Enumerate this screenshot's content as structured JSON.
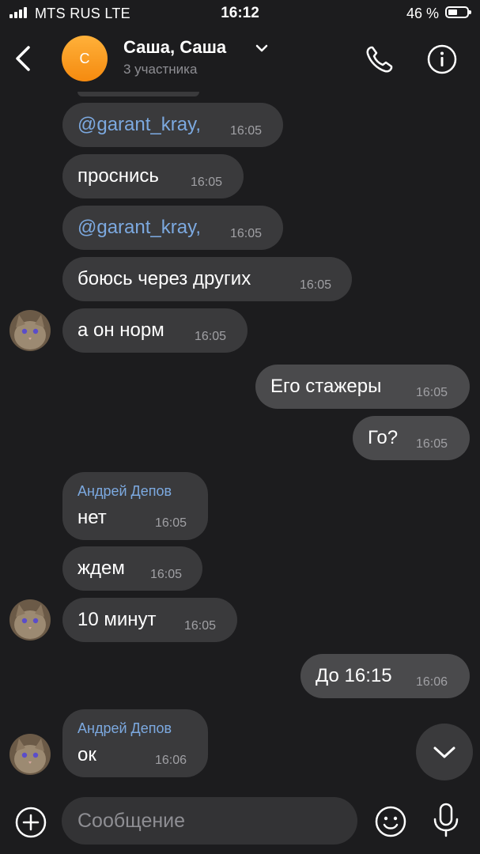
{
  "status": {
    "carrier": "MTS RUS  LTE",
    "time": "16:12",
    "battery": "46 %"
  },
  "header": {
    "avatar_letter": "С",
    "title": "Саша, Саша",
    "subtitle": "3 участника"
  },
  "messages": [
    {
      "id": "m1",
      "text": "@garant_kray,",
      "time": "16:05",
      "mention": true
    },
    {
      "id": "m2",
      "text": "проснись",
      "time": "16:05"
    },
    {
      "id": "m3",
      "text": "@garant_kray,",
      "time": "16:05",
      "mention": true
    },
    {
      "id": "m4",
      "text": "боюсь через других",
      "time": "16:05"
    },
    {
      "id": "m5",
      "text": "а он норм",
      "time": "16:05"
    },
    {
      "id": "m6",
      "text": "Его стажеры",
      "time": "16:05",
      "outgoing": true
    },
    {
      "id": "m7",
      "text": "Го?",
      "time": "16:05",
      "outgoing": true
    },
    {
      "id": "m8",
      "sender": "Андрей Депов",
      "text": "нет",
      "time": "16:05"
    },
    {
      "id": "m9",
      "text": "ждем",
      "time": "16:05"
    },
    {
      "id": "m10",
      "text": "10 минут",
      "time": "16:05"
    },
    {
      "id": "m11",
      "text": "До 16:15",
      "time": "16:06",
      "outgoing": true
    },
    {
      "id": "m12",
      "sender": "Андрей Депов",
      "text": "ок",
      "time": "16:06"
    }
  ],
  "composer": {
    "placeholder": "Сообщение"
  },
  "colors": {
    "background": "#1c1c1e",
    "bubble_in": "#3a3a3c",
    "bubble_out": "#4a4a4c",
    "mention": "#7ca9e0",
    "avatar": "#f58a0f"
  }
}
